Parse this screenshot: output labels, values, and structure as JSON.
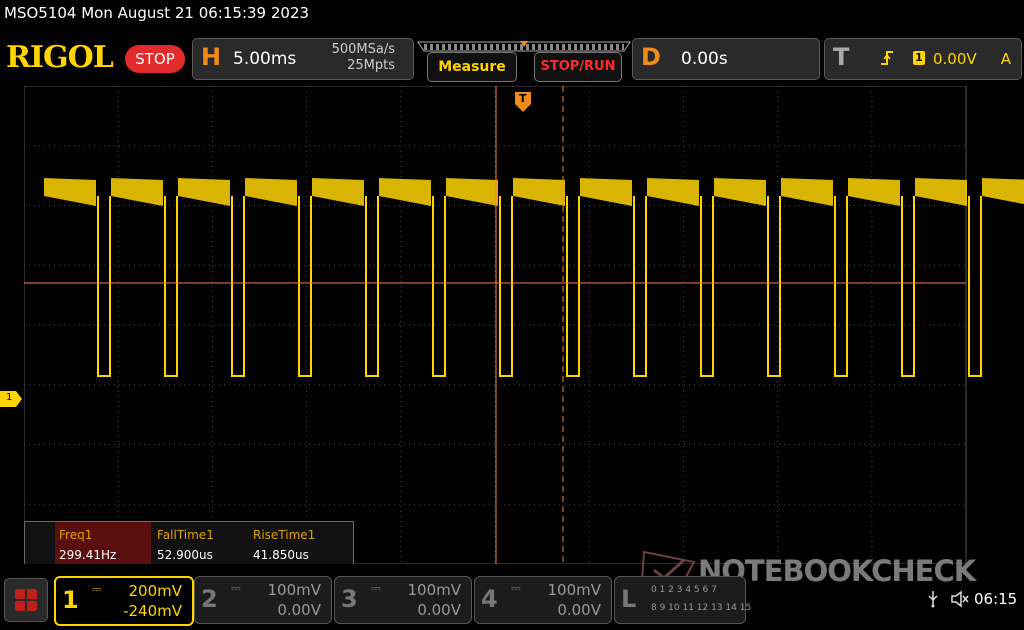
{
  "header": {
    "title": "MSO5104  Mon August 21 06:15:39 2023",
    "logo": "RIGOL",
    "state": "STOP"
  },
  "horizontal": {
    "letter": "H",
    "timebase": "5.00ms",
    "sample_rate": "500MSa/s",
    "memory_depth": "25Mpts"
  },
  "buttons": {
    "measure": "Measure",
    "stop_run": "STOP/RUN"
  },
  "delay": {
    "letter": "D",
    "value": "0.00s"
  },
  "trigger": {
    "letter": "T",
    "source": "1",
    "level": "0.00V",
    "mode": "A"
  },
  "channel_marker": "1",
  "trigger_position_marker": "T",
  "measurements": [
    {
      "label": "Freq1",
      "value": "299.41Hz"
    },
    {
      "label": "FallTime1",
      "value": "52.900us"
    },
    {
      "label": "RiseTime1",
      "value": "41.850us"
    }
  ],
  "channels": [
    {
      "num": "1",
      "scale": "200mV",
      "offset": "-240mV"
    },
    {
      "num": "2",
      "scale": "100mV",
      "offset": "0.00V"
    },
    {
      "num": "3",
      "scale": "100mV",
      "offset": "0.00V"
    },
    {
      "num": "4",
      "scale": "100mV",
      "offset": "0.00V"
    }
  ],
  "logic": {
    "letter": "L",
    "row1": "0 1 2 3 4 5 6 7",
    "row2": "8 9 10 11 12 13 14 15"
  },
  "status": {
    "time": "06:15"
  },
  "watermark": "NOTEBOOKCHECK",
  "colors": {
    "signal": "#ffd400",
    "cursor": "#ff7a4a",
    "grid": "#4a4a4a",
    "accent_orange": "#f08a1d",
    "stop_red": "#e12b2b"
  },
  "icons": {
    "menu": "grid-menu-icon",
    "usb": "usb-icon",
    "sound": "speaker-muted-icon",
    "trigger_edge": "rising-edge-icon"
  }
}
